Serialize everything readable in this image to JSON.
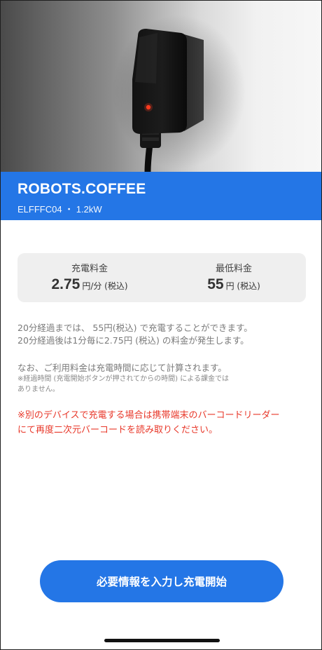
{
  "hero": {
    "image_icon": "ev-charger-image"
  },
  "station": {
    "name": "ROBOTS.COFFEE",
    "subtitle": "ELFFFC04 ・ 1.2kW"
  },
  "pricing": {
    "charge_fee": {
      "label": "充電料金",
      "value": "2.75",
      "unit": "円/分 (税込)"
    },
    "minimum_fee": {
      "label": "最低料金",
      "value": "55",
      "unit": "円 (税込)"
    }
  },
  "info": {
    "line1": "20分経過までは、 55円(税込) で充電することができます。",
    "line2": "20分経過後は1分毎に2.75円 (税込) の料金が発生します。",
    "line3": "なお、ご利用料金は充電時間に応じて計算されます。",
    "note_line1": "※経過時間 (充電開始ボタンが押されてからの時間) による課金では",
    "note_line2": "ありません。"
  },
  "warning": {
    "line1": "※別のデバイスで充電する場合は携帯端末のバーコードリーダー",
    "line2": "にて再度二次元バーコードを読み取りください。"
  },
  "actions": {
    "start_label": "必要情報を入力し充電開始"
  },
  "colors": {
    "brand": "#2476e6",
    "warning": "#e8382a"
  }
}
